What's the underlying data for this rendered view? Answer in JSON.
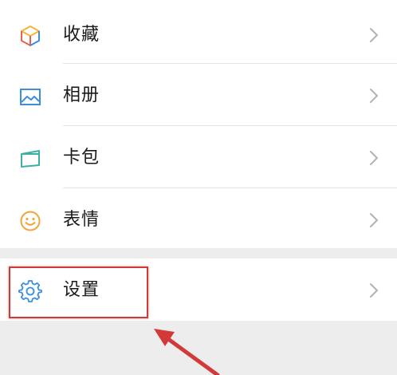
{
  "menu": {
    "items": [
      {
        "label": "收藏",
        "icon": "favorites-cube-icon"
      },
      {
        "label": "相册",
        "icon": "photo-album-icon"
      },
      {
        "label": "卡包",
        "icon": "card-wallet-icon"
      },
      {
        "label": "表情",
        "icon": "smiley-face-icon"
      }
    ],
    "settings": {
      "label": "设置",
      "icon": "gear-icon"
    }
  },
  "colors": {
    "background": "#ededed",
    "row_background": "#ffffff",
    "text": "#1a1a1a",
    "divider": "#e5e5e5",
    "chevron": "#b2b2b2",
    "highlight": "#d23a3a"
  }
}
